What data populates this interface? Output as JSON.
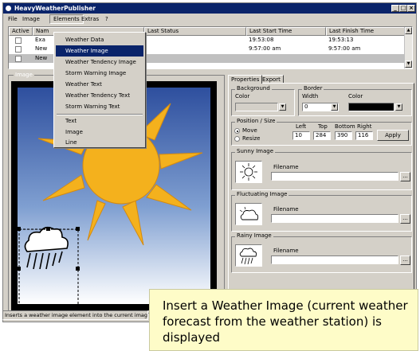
{
  "window": {
    "title": "HeavyWeatherPublisher",
    "controls": [
      "_",
      "□",
      "×"
    ]
  },
  "menubar": {
    "items": [
      "File",
      "Image",
      "Elements",
      "Extras",
      "?"
    ],
    "active": "Elements"
  },
  "jobs_grid": {
    "columns": [
      "Active",
      "Nam",
      "Last Status",
      "Last Start Time",
      "Last Finish Time"
    ],
    "rows": [
      {
        "active": false,
        "name": "Exa",
        "start": "19:53:08",
        "finish": "19:53:13"
      },
      {
        "active": false,
        "name": "New",
        "start": "9:57:00 am",
        "finish": "9:57:00 am"
      },
      {
        "active": false,
        "name": "New",
        "start": "",
        "finish": ""
      }
    ]
  },
  "image_group": {
    "label": "Image"
  },
  "elements_menu": {
    "items": [
      {
        "label": "Weather Data",
        "selected": false
      },
      {
        "label": "Weather Image",
        "selected": true
      },
      {
        "label": "Weather Tendency Image",
        "selected": false
      },
      {
        "label": "Storm Warning Image",
        "selected": false
      },
      {
        "label": "Weather Text",
        "selected": false
      },
      {
        "label": "Weather Tendency Text",
        "selected": false
      },
      {
        "label": "Storm Warning Text",
        "selected": false
      },
      {
        "label": "Text",
        "selected": false
      },
      {
        "label": "Image",
        "selected": false
      },
      {
        "label": "Line",
        "selected": false
      }
    ]
  },
  "properties": {
    "tabs": [
      "Properties",
      "Export"
    ],
    "active_tab": "Properties",
    "background": {
      "title": "Background",
      "color_label": "Color"
    },
    "border": {
      "title": "Border",
      "width_label": "Width",
      "width_value": "0",
      "color_label": "Color"
    },
    "position": {
      "title": "Position / Size",
      "move_label": "Move",
      "resize_label": "Resize",
      "mode": "Move",
      "left_label": "Left",
      "left_value": "10",
      "top_label": "Top",
      "top_value": "284",
      "bottom_label": "Bottom",
      "bottom_value": "390",
      "right_label": "Right",
      "right_value": "116",
      "apply_label": "Apply"
    },
    "sunny": {
      "title": "Sunny Image",
      "filename_label": "Filename",
      "browse_label": "..."
    },
    "fluctuating": {
      "title": "Fluctuating Image",
      "filename_label": "Filename",
      "browse_label": "..."
    },
    "rainy": {
      "title": "Rainy Image",
      "filename_label": "Filename",
      "browse_label": "..."
    }
  },
  "statusbar": {
    "text": "Inserts a weather image element into the current image"
  },
  "callout": {
    "text": "Insert a Weather Image (current weather forecast from the weather station) is displayed"
  },
  "colors": {
    "titlebar": "#0a246a",
    "menu_highlight": "#0a246a",
    "sky_top": "#2e4f9e",
    "sky_bottom": "#ffffff",
    "sun": "#f4b11d",
    "callout_bg": "#fefcc8",
    "border_color_swatch": "#000000"
  }
}
